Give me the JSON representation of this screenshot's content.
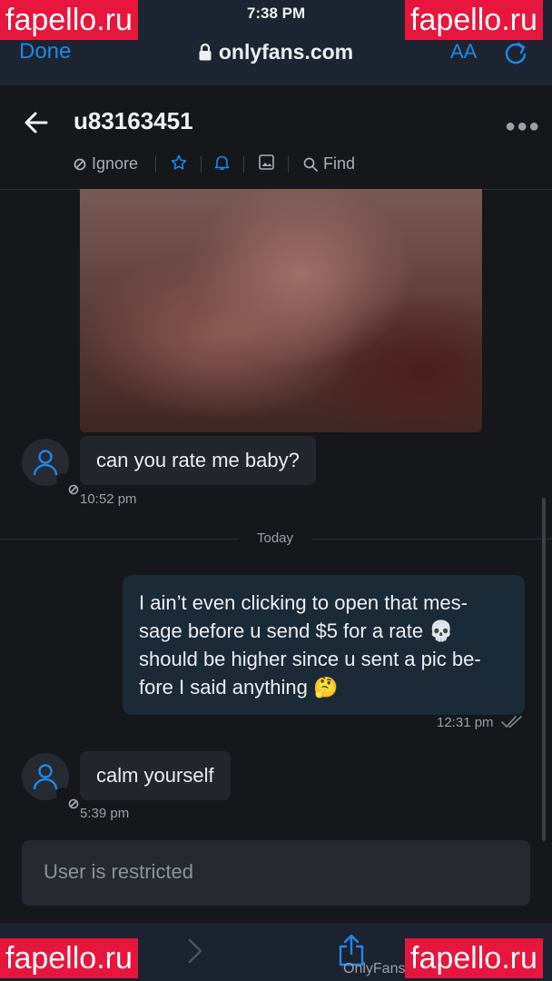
{
  "status": {
    "time": "7:38 PM"
  },
  "browser": {
    "done_label": "Done",
    "url": "onlyfans.com",
    "text_size_label": "AA",
    "footer_host": "OnlyFans"
  },
  "watermark": {
    "text": "fapello.ru",
    "color": "#e8153c"
  },
  "chat": {
    "username": "u83163451",
    "toolbar": {
      "ignore_label": "Ignore",
      "find_label": "Find"
    },
    "today_label": "Today",
    "messages": [
      {
        "direction": "in",
        "text": "can you rate me baby?",
        "time": "10:52 pm"
      },
      {
        "direction": "out",
        "lines": [
          "I ain’t even clicking to open that mes-",
          "sage before u send $5 for a rate 💀",
          "should be higher since u sent a pic be-",
          "fore I said anything 🤔"
        ],
        "time": "12:31 pm"
      },
      {
        "direction": "in",
        "text": "calm yourself",
        "time": "5:39 pm"
      }
    ],
    "restricted_label": "User is restricted"
  },
  "colors": {
    "accent": "#1f88e5",
    "background": "#15171b",
    "outgoing_bubble": "#1a2a36",
    "incoming_bubble": "#23262c"
  }
}
